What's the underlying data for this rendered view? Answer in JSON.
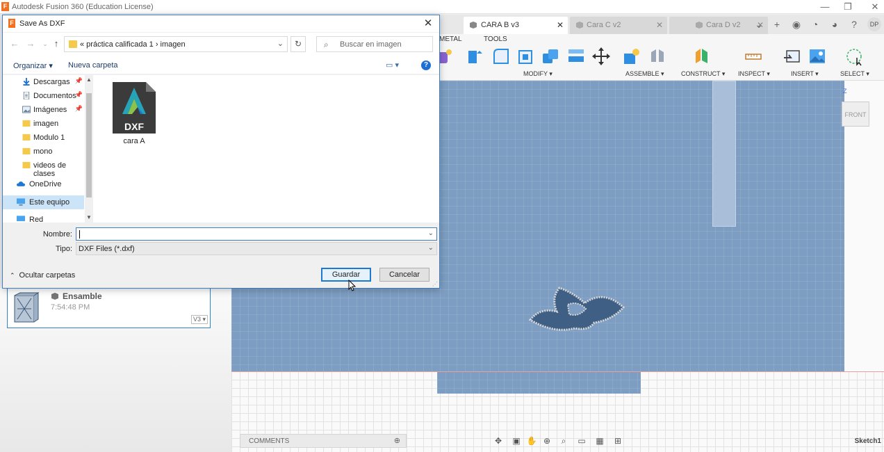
{
  "app": {
    "title": "Autodesk Fusion 360 (Education License)",
    "window_controls": [
      "—",
      "❐",
      "✕"
    ]
  },
  "doc_tabs": [
    {
      "label": "CARA B v3",
      "active": true,
      "close": "✕"
    },
    {
      "label": "Cara C v2",
      "active": false,
      "close": "✕"
    },
    {
      "label": "Cara D v2",
      "active": false,
      "close": "✕"
    }
  ],
  "user_initials": "DP",
  "toolbar": {
    "tabs": [
      "METAL",
      "TOOLS"
    ],
    "groups": [
      "MODIFY ▾",
      "ASSEMBLE ▾",
      "CONSTRUCT ▾",
      "INSPECT ▾",
      "INSERT ▾",
      "SELECT ▾"
    ]
  },
  "viewcube_label": "FRONT",
  "viewcube_axis": "Z",
  "browser": {
    "recent_card": {
      "name": "Ensamble",
      "time": "7:54:48 PM",
      "version": "V3 ▾"
    }
  },
  "statusbar": {
    "comments": "COMMENTS",
    "sketch": "Sketch1"
  },
  "dialog": {
    "title": "Save As DXF",
    "close": "✕",
    "breadcrumb": "«  práctica calificada 1  ›  imagen",
    "search_placeholder": "Buscar en imagen",
    "organize": "Organizar ▾",
    "new_folder": "Nueva carpeta",
    "help": "?",
    "nav_items": [
      {
        "label": "Descargas",
        "pinned": true,
        "icon": "download-icon"
      },
      {
        "label": "Documentos",
        "pinned": true,
        "icon": "document-icon"
      },
      {
        "label": "Imágenes",
        "pinned": true,
        "icon": "image-icon"
      },
      {
        "label": "imagen",
        "pinned": false,
        "icon": "folder-icon"
      },
      {
        "label": "Modulo 1",
        "pinned": false,
        "icon": "folder-icon"
      },
      {
        "label": "mono",
        "pinned": false,
        "icon": "folder-icon"
      },
      {
        "label": "videos de clases",
        "pinned": false,
        "icon": "folder-icon"
      },
      {
        "label": "OneDrive",
        "pinned": false,
        "icon": "cloud-icon"
      },
      {
        "label": "Este equipo",
        "pinned": false,
        "icon": "computer-icon",
        "selected": true
      },
      {
        "label": "Red",
        "pinned": false,
        "icon": "network-icon"
      }
    ],
    "file": {
      "name": "cara A",
      "badge": "DXF"
    },
    "name_label": "Nombre:",
    "name_value": "",
    "type_label": "Tipo:",
    "type_value": "DXF Files (*.dxf)",
    "hide_folders": "Ocultar carpetas",
    "save_button": "Guardar",
    "cancel_button": "Cancelar"
  },
  "colors": {
    "accent": "#1e78d2",
    "sketch_plane": "#7d9dc2",
    "fusion_orange": "#f37021"
  }
}
